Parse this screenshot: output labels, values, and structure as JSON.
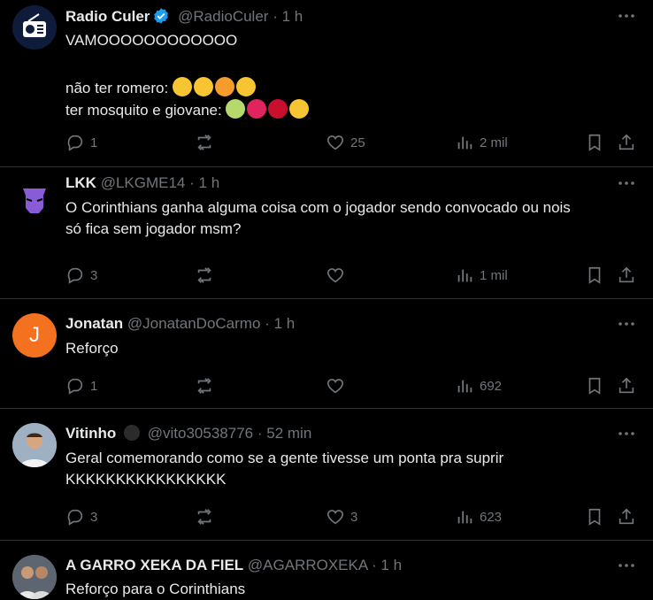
{
  "tweets": [
    {
      "name": "Radio Culer",
      "handle": "@RadioCuler",
      "time": "1 h",
      "lines": [
        "VAMOOOOOOOOOOOO",
        "",
        "não ter romero:",
        "ter mosquito e giovane:"
      ],
      "replies": "1",
      "retweets": "",
      "likes": "25",
      "views": "2 mil"
    },
    {
      "name": "LKK",
      "handle": "@LKGME14",
      "time": "1 h",
      "lines": [
        "O Corinthians ganha alguma coisa com o jogador sendo convocado ou nois",
        "só fica sem jogador msm?"
      ],
      "replies": "3",
      "retweets": "",
      "likes": "",
      "views": "1 mil"
    },
    {
      "name": "Jonatan",
      "handle": "@JonatanDoCarmo",
      "time": "1 h",
      "avatar_letter": "J",
      "lines": [
        "Reforço"
      ],
      "replies": "1",
      "retweets": "",
      "likes": "",
      "views": "692"
    },
    {
      "name": "Vitinho",
      "handle": "@vito30538776",
      "time": "52 min",
      "lines": [
        "Geral comemorando como se a gente tivesse um ponta pra suprir",
        "KKKKKKKKKKKKKKKK"
      ],
      "replies": "3",
      "retweets": "",
      "likes": "3",
      "views": "623"
    },
    {
      "name": "A GARRO XEKA DA FIEL",
      "handle": "@AGARROXEKA",
      "time": "1 h",
      "lines": [
        "Reforço para o Corinthians"
      ]
    }
  ],
  "colors": {
    "background": "#000000",
    "text": "#e7e9ea",
    "muted": "#71767b",
    "divider": "#2f3336",
    "verified": "#1d9bf0",
    "jonatan_avatar": "#f4711f"
  },
  "icons": [
    "radio-icon",
    "verified-badge-icon",
    "more-icon",
    "reply-icon",
    "retweet-icon",
    "like-icon",
    "views-icon",
    "bookmark-icon",
    "share-icon"
  ]
}
